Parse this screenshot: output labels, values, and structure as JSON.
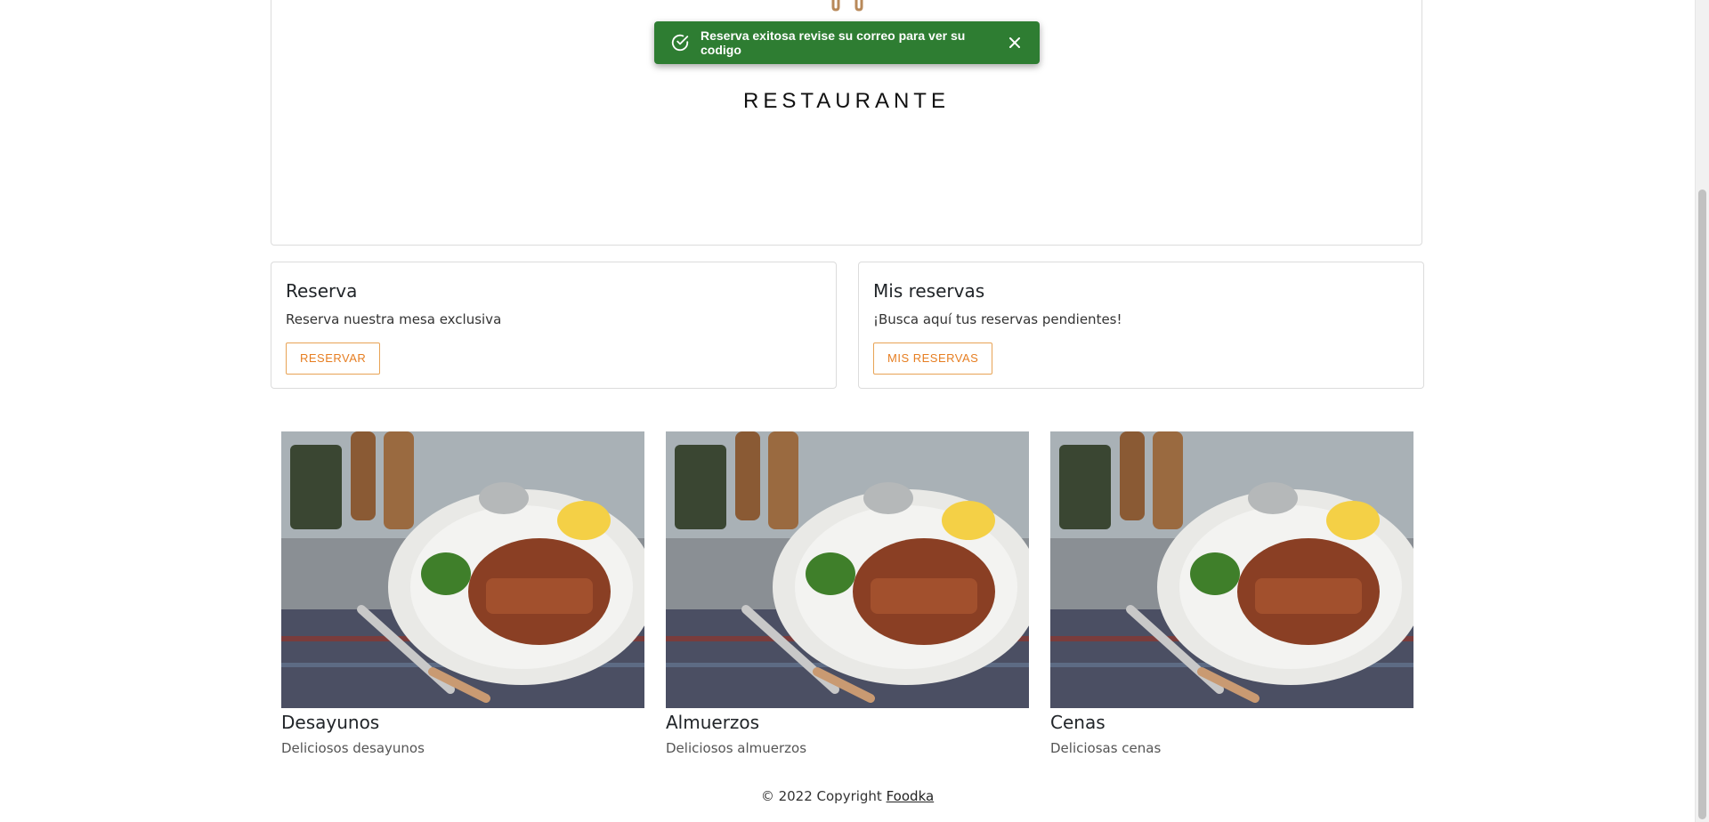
{
  "hero": {
    "title": "RESTAURANTE"
  },
  "toast": {
    "message": "Reserva exitosa revise su correo para ver su codigo",
    "icon": "check-circle-icon",
    "close_icon": "close-icon",
    "color": "#2e7d32"
  },
  "cards": [
    {
      "title": "Reserva",
      "text": "Reserva nuestra mesa exclusiva",
      "button": "RESERVAR"
    },
    {
      "title": "Mis reservas",
      "text": "¡Busca aquí tus reservas pendientes!",
      "button": "MIS RESERVAS"
    }
  ],
  "categories": [
    {
      "name": "Desayunos",
      "desc": "Deliciosos desayunos"
    },
    {
      "name": "Almuerzos",
      "desc": "Deliciosos almuerzos"
    },
    {
      "name": "Cenas",
      "desc": "Deliciosas cenas"
    }
  ],
  "footer": {
    "text": "© 2022 Copyright ",
    "link": "Foodka"
  },
  "colors": {
    "accent": "#e67e22",
    "toast_bg": "#2e7d32"
  }
}
